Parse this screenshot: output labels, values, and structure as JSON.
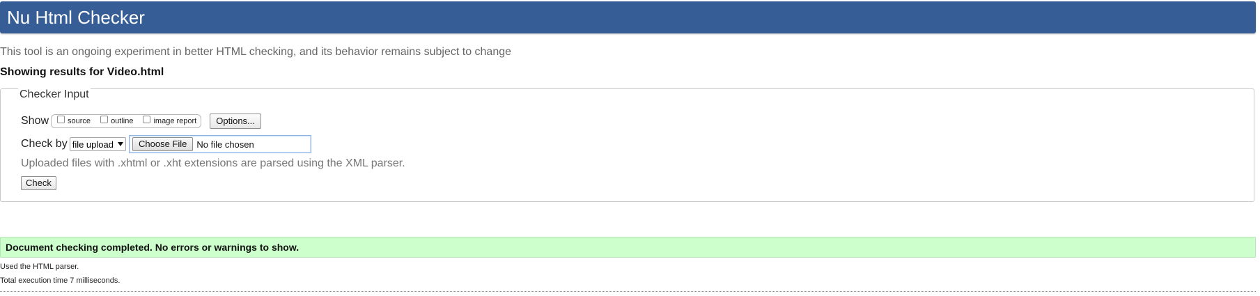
{
  "header": {
    "title": "Nu Html Checker",
    "bg_color": "#365D95"
  },
  "intro_text": "This tool is an ongoing experiment in better HTML checking, and its behavior remains subject to change",
  "results_for": "Showing results for Video.html",
  "checker_input": {
    "legend": "Checker Input",
    "show": {
      "label": "Show",
      "options": [
        {
          "label": "source",
          "checked": false
        },
        {
          "label": "outline",
          "checked": false
        },
        {
          "label": "image report",
          "checked": false
        }
      ],
      "options_button": "Options..."
    },
    "check_by": {
      "label": "Check by",
      "selected": "file upload",
      "choose_file_button": "Choose File",
      "file_status": "No file chosen"
    },
    "note": "Uploaded files with .xhtml or .xht extensions are parsed using the XML parser.",
    "check_button": "Check"
  },
  "result": {
    "success_message": "Document checking completed. No errors or warnings to show.",
    "success_bg": "#ccffcc",
    "parser_note": "Used the HTML parser.",
    "execution_time": "Total execution time 7 milliseconds."
  }
}
